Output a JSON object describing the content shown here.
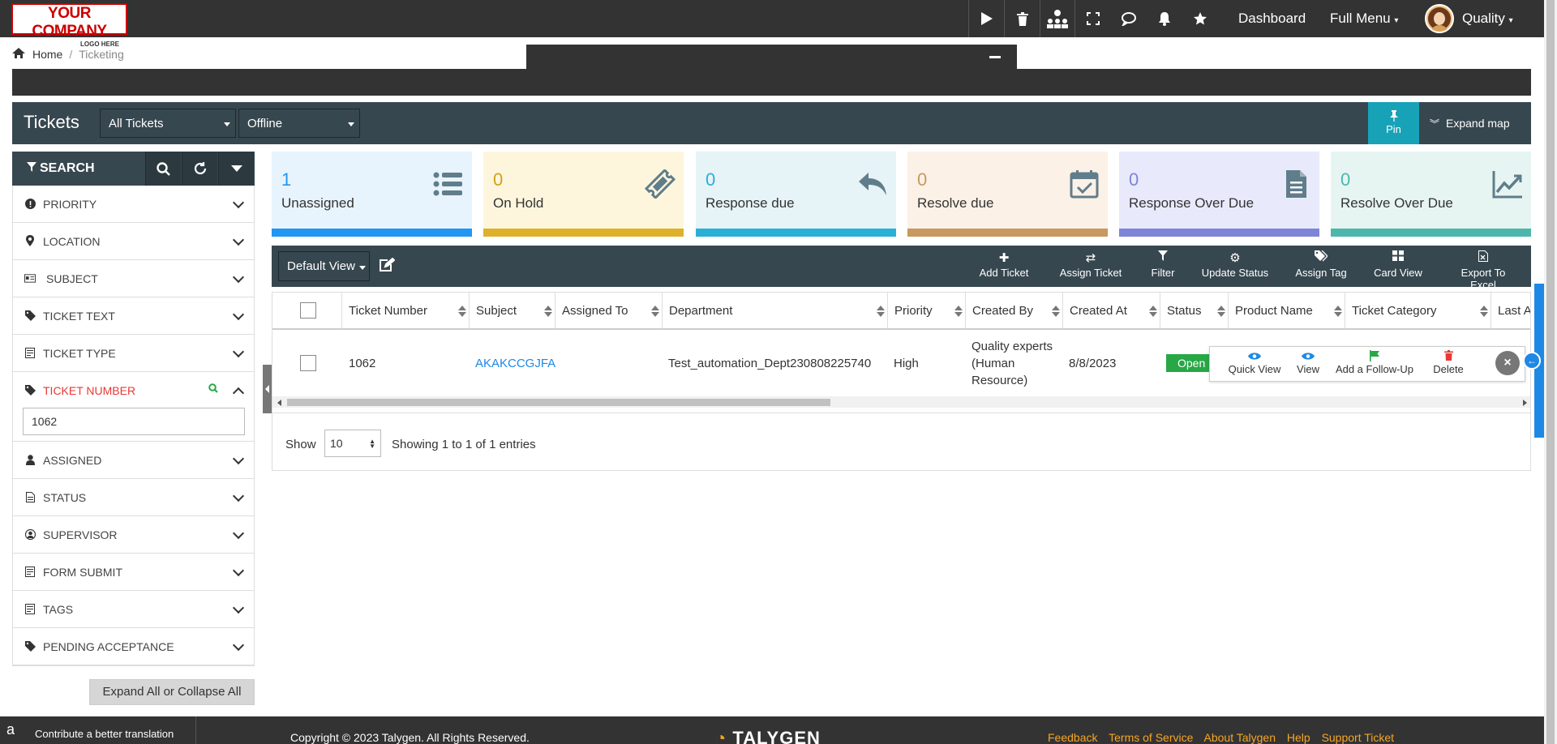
{
  "topbar": {
    "logo_line1": "YOUR COMPANY",
    "logo_line2": "LOGO HERE",
    "links": {
      "dashboard": "Dashboard",
      "full_menu": "Full Menu",
      "user": "Quality"
    }
  },
  "breadcrumb": {
    "home": "Home",
    "separator": "/",
    "current": "Ticketing"
  },
  "tickets_header": {
    "title": "Tickets",
    "filter_select": "All Tickets",
    "mode_select": "Offline",
    "pin_label": "Pin",
    "expand_map_label": "Expand map"
  },
  "sidebar": {
    "search_label": "SEARCH",
    "items": [
      {
        "label": "PRIORITY",
        "icon": "exclamation-circle-icon"
      },
      {
        "label": "LOCATION",
        "icon": "map-marker-icon"
      },
      {
        "label": "SUBJECT",
        "icon": "id-card-icon"
      },
      {
        "label": "TICKET TEXT",
        "icon": "ticket-icon"
      },
      {
        "label": "TICKET TYPE",
        "icon": "form-icon"
      },
      {
        "label": "TICKET NUMBER",
        "icon": "ticket-icon",
        "value": "1062"
      },
      {
        "label": "ASSIGNED",
        "icon": "user-icon"
      },
      {
        "label": "STATUS",
        "icon": "document-icon"
      },
      {
        "label": "SUPERVISOR",
        "icon": "user-circle-icon"
      },
      {
        "label": "FORM SUBMIT",
        "icon": "form-icon"
      },
      {
        "label": "TAGS",
        "icon": "form-icon"
      },
      {
        "label": "PENDING ACCEPTANCE",
        "icon": "ticket-icon"
      }
    ],
    "expand_all": "Expand All or Collapse All"
  },
  "cards": [
    {
      "count": "1",
      "label": "Unassigned",
      "bg": "#e8f4fd",
      "bar": "#2196f3",
      "num_color": "#2196f3"
    },
    {
      "count": "0",
      "label": "On Hold",
      "bg": "#fdf6dd",
      "bar": "#dfb12a",
      "num_color": "#d4a017"
    },
    {
      "count": "0",
      "label": "Response due",
      "bg": "#e6f3f7",
      "bar": "#29b0d6",
      "num_color": "#29b0d6"
    },
    {
      "count": "0",
      "label": "Resolve due",
      "bg": "#fbf1e6",
      "bar": "#c8985f",
      "num_color": "#c8985f"
    },
    {
      "count": "0",
      "label": "Response Over Due",
      "bg": "#e8eafc",
      "bar": "#7e84d6",
      "num_color": "#7e84d6"
    },
    {
      "count": "0",
      "label": "Resolve Over Due",
      "bg": "#e7f5f2",
      "bar": "#4db6ac",
      "num_color": "#4db6ac"
    }
  ],
  "toolbar": {
    "view": "Default View",
    "actions": [
      "Add Ticket",
      "Assign Ticket",
      "Filter",
      "Update Status",
      "Assign Tag",
      "Card View",
      "Export To Excel"
    ]
  },
  "table": {
    "columns": [
      "Ticket Number",
      "Subject",
      "Assigned To",
      "Department",
      "Priority",
      "Created By",
      "Created At",
      "Status",
      "Product Name",
      "Ticket Category",
      "Last A"
    ],
    "row": {
      "ticket_number": "1062",
      "subject": "AKAKCCGJFA",
      "assigned_to": "",
      "department": "Test_automation_Dept230808225740",
      "priority": "High",
      "created_by_1": "Quality experts",
      "created_by_2": "(Human",
      "created_by_3": "Resource)",
      "created_at": "8/8/2023",
      "status": "Open"
    },
    "row_actions": [
      "Quick View",
      "View",
      "Add a Follow-Up",
      "Delete"
    ]
  },
  "pager": {
    "show": "Show",
    "page_size": "10",
    "info": "Showing 1 to 1 of 1 entries"
  },
  "footer": {
    "translate": "Contribute a better translation",
    "copyright": "Copyright © 2023 Talygen. All Rights Reserved.",
    "brand": "TALYGEN",
    "links": [
      "Feedback",
      "Terms of Service",
      "About Talygen",
      "Help",
      "Support Ticket"
    ]
  }
}
